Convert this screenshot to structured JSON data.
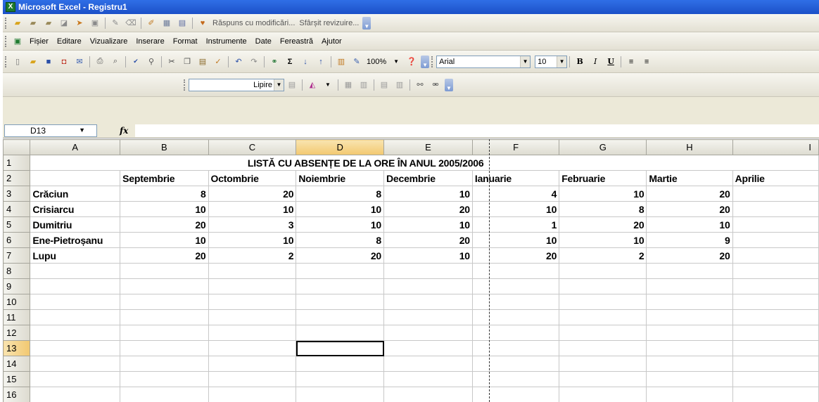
{
  "window": {
    "title": "Microsoft Excel - Registru1",
    "app_icon": "excel-icon"
  },
  "review_toolbar": {
    "reply_text": "Răspuns cu modificări...",
    "end_review_text": "Sfârșit revizuire..."
  },
  "menu": {
    "items": [
      "Fișier",
      "Editare",
      "Vizualizare",
      "Inserare",
      "Format",
      "Instrumente",
      "Date",
      "Fereastră",
      "Ajutor"
    ]
  },
  "standard_toolbar": {
    "zoom": "100%",
    "font_name": "Arial",
    "font_size": "10",
    "bold": "B",
    "italic": "I",
    "underline": "U"
  },
  "drawing_toolbar": {
    "paste_label": "Lipire"
  },
  "formula_bar": {
    "cell_ref": "D13",
    "fx_label": "fx",
    "formula": ""
  },
  "grid": {
    "columns": [
      "A",
      "B",
      "C",
      "D",
      "E",
      "F",
      "G",
      "H",
      "I"
    ],
    "row_numbers": [
      "1",
      "2",
      "3",
      "4",
      "5",
      "6",
      "7",
      "8",
      "9",
      "10",
      "11",
      "12",
      "13",
      "14",
      "15",
      "16"
    ],
    "selected_cell": "D13",
    "title": "LISTĂ CU ABSENȚE DE LA ORE ÎN ANUL 2005/2006",
    "month_headers": [
      "Septembrie",
      "Octombrie",
      "Noiembrie",
      "Decembrie",
      "Ianuarie",
      "Februarie",
      "Martie",
      "Aprilie"
    ],
    "rows": [
      {
        "name": "Crăciun",
        "values": [
          "8",
          "20",
          "8",
          "10",
          "4",
          "10",
          "20"
        ]
      },
      {
        "name": "Crisiarcu",
        "values": [
          "10",
          "10",
          "10",
          "20",
          "10",
          "8",
          "20"
        ]
      },
      {
        "name": "Dumitriu",
        "values": [
          "20",
          "3",
          "10",
          "10",
          "1",
          "20",
          "10"
        ]
      },
      {
        "name": "Ene-Pietroșanu",
        "values": [
          "10",
          "10",
          "8",
          "20",
          "10",
          "10",
          "9"
        ]
      },
      {
        "name": "Lupu",
        "values": [
          "20",
          "2",
          "20",
          "10",
          "20",
          "2",
          "20"
        ]
      }
    ]
  }
}
